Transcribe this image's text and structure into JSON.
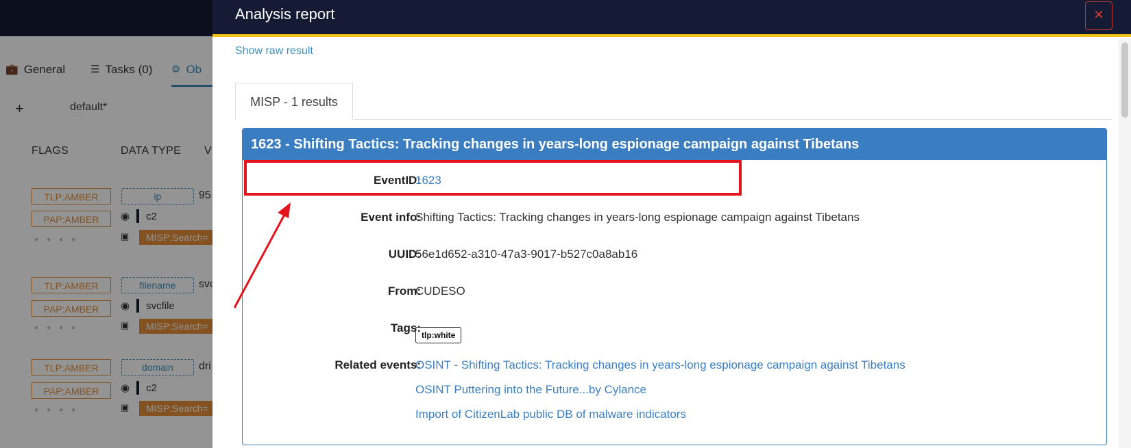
{
  "background": {
    "tabs": [
      {
        "label": "General",
        "icon": "briefcase-icon"
      },
      {
        "label": "Tasks (0)",
        "icon": "list-icon"
      },
      {
        "label": "Ob",
        "icon": "gear-icon"
      }
    ],
    "add_label": "+",
    "filter_label": "default*",
    "columns": [
      "FLAGS",
      "DATA TYPE",
      "V"
    ],
    "observables": [
      {
        "tlp": "TLP:AMBER",
        "pap": "PAP:AMBER",
        "data_type": "ip",
        "value": "95",
        "tag": "c2",
        "analyzer": "MISP:Search="
      },
      {
        "tlp": "TLP:AMBER",
        "pap": "PAP:AMBER",
        "data_type": "filename",
        "value": "svc",
        "tag": "svcfile",
        "analyzer": "MISP:Search="
      },
      {
        "tlp": "TLP:AMBER",
        "pap": "PAP:AMBER",
        "data_type": "domain",
        "value": "dri",
        "tag": "c2",
        "analyzer": "MISP:Search="
      }
    ]
  },
  "modal": {
    "title": "Analysis report",
    "close_label": "×",
    "raw_link": "Show raw result",
    "tab_label": "MISP - 1 results",
    "panel_title": "1623 - Shifting Tactics: Tracking changes in years-long espionage campaign against Tibetans",
    "fields": {
      "event_id_label": "EventID:",
      "event_id": "1623",
      "event_info_label": "Event info:",
      "event_info": "Shifting Tactics: Tracking changes in years-long espionage campaign against Tibetans",
      "uuid_label": "UUID:",
      "uuid": "56e1d652-a310-47a3-9017-b527c0a8ab16",
      "from_label": "From:",
      "from": "CUDESO",
      "tags_label": "Tags:",
      "tag": "tlp:white",
      "related_label": "Related events:",
      "related": [
        "OSINT - Shifting Tactics: Tracking changes in years-long espionage campaign against Tibetans",
        "OSINT Puttering into the Future...by Cylance",
        "Import of CitizenLab public DB of malware indicators"
      ]
    }
  },
  "colors": {
    "header_bg": "#151b35",
    "accent_yellow": "#f3c417",
    "panel_blue": "#3b7dc1",
    "link_blue": "#3c7fc1",
    "annotation_red": "#e3141b",
    "amber": "#e38d3a"
  }
}
